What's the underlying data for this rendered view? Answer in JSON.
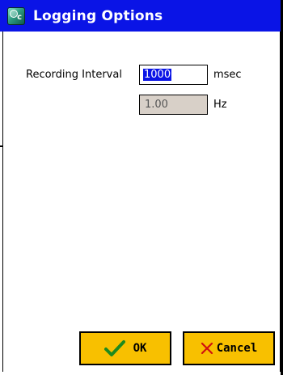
{
  "window": {
    "title": "Logging Options",
    "icon": "app-logo-icon"
  },
  "form": {
    "interval_label": "Recording Interval",
    "interval_value": "1000",
    "interval_unit": "msec",
    "frequency_value": "1.00",
    "frequency_unit": "Hz"
  },
  "buttons": {
    "ok_label": "OK",
    "ok_icon": "checkmark-icon",
    "cancel_label": "Cancel",
    "cancel_icon": "close-icon"
  },
  "colors": {
    "titlebar": "#0a14e6",
    "button_bg": "#f8c000",
    "selection": "#0a14e6",
    "readonly_field_bg": "#d8d0c8",
    "ok_icon_color": "#1e8a1e",
    "cancel_icon_color": "#d01010"
  }
}
